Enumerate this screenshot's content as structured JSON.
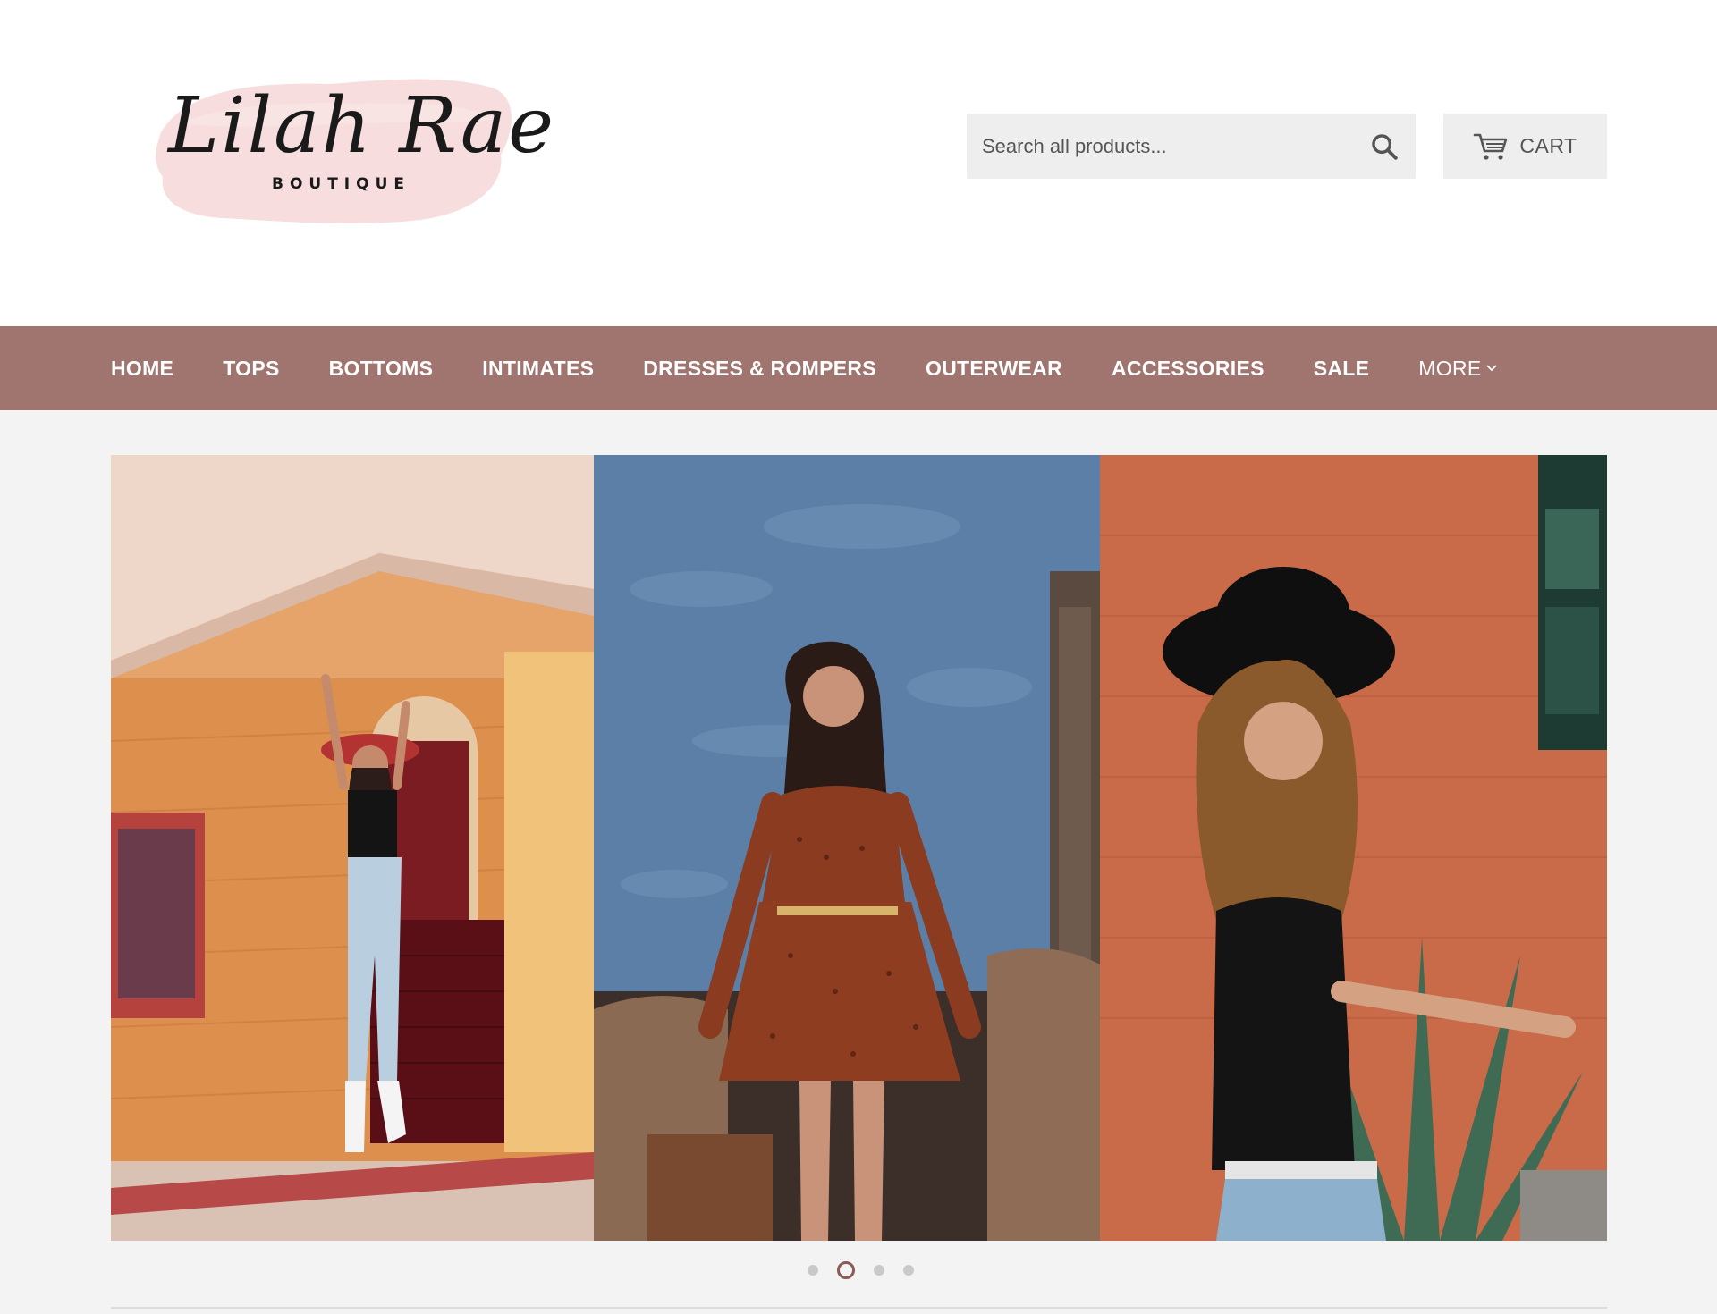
{
  "brand": {
    "name_script": "Lilah Rae",
    "name_sub": "BOUTIQUE",
    "accent_color": "#a07570",
    "logo_wash_color": "#f6d9d9"
  },
  "search": {
    "placeholder": "Search all products...",
    "icon": "search-icon"
  },
  "cart": {
    "label": "CART",
    "icon": "cart-icon"
  },
  "nav": {
    "items": [
      {
        "label": "HOME"
      },
      {
        "label": "TOPS"
      },
      {
        "label": "BOTTOMS"
      },
      {
        "label": "INTIMATES"
      },
      {
        "label": "DRESSES & ROMPERS"
      },
      {
        "label": "OUTERWEAR"
      },
      {
        "label": "ACCESSORIES"
      },
      {
        "label": "SALE"
      }
    ],
    "more_label": "MORE",
    "more_icon": "chevron-down-icon"
  },
  "slideshow": {
    "slide_count": 4,
    "active_slide": 2
  }
}
